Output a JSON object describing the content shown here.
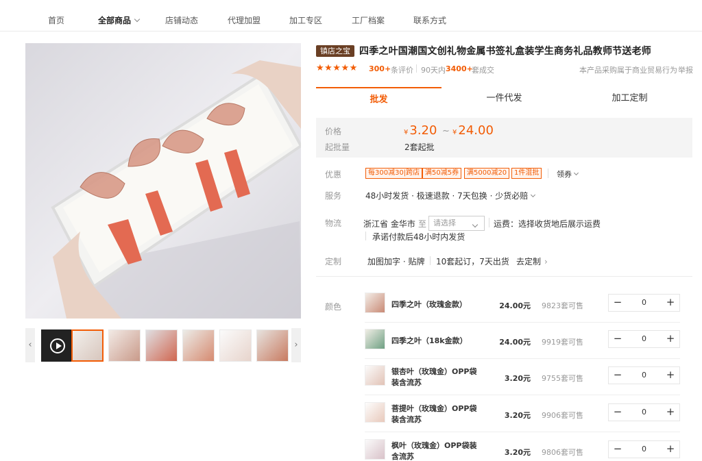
{
  "nav": {
    "items": [
      "首页",
      "全部商品",
      "店铺动态",
      "代理加盟",
      "加工专区",
      "工厂档案",
      "联系方式"
    ]
  },
  "product": {
    "badge": "镇店之宝",
    "title": "四季之叶国潮国文创礼物金属书签礼盒装学生商务礼品教师节送老师",
    "reviews_count": "300+",
    "reviews_label": "条评价",
    "period": "90天内",
    "sold_count": "3400+",
    "sold_label": "套成交",
    "business_note": "本产品采购属于商业贸易行为",
    "report_label": "举报"
  },
  "tabs": [
    "批发",
    "一件代发",
    "加工定制"
  ],
  "pricing": {
    "price_label": "价格",
    "currency": "¥",
    "price_min": "3.20",
    "tilde": "~",
    "price_max": "24.00",
    "moq_label": "起批量",
    "moq_value": "2套起批"
  },
  "offers": {
    "label": "优惠",
    "promos": [
      "每300减30|跨店",
      "满50减5券",
      "满5000减20",
      "1件混批"
    ],
    "coupon_label": "领券"
  },
  "service": {
    "label": "服务",
    "text": "48小时发货 · 极速退款 · 7天包换 · 少货必赔"
  },
  "logistics": {
    "label": "物流",
    "origin": "浙江省 金华市",
    "to": "至",
    "select_placeholder": "请选择",
    "freight": "运费：选择收货地后展示运费",
    "promise": "承诺付款后48小时内发货"
  },
  "custom": {
    "label": "定制",
    "service": "加图加字 · 贴牌",
    "terms": "10套起订，7天出货",
    "link": "去定制"
  },
  "sku_label": "颜色",
  "skus": [
    {
      "name": "四季之叶（玫瑰金款）",
      "price": "24.00元",
      "stock": "9823套可售",
      "qty": "0"
    },
    {
      "name": "四季之叶（18k金款）",
      "price": "24.00元",
      "stock": "9919套可售",
      "qty": "0"
    },
    {
      "name": "银杏叶（玫瑰金）OPP袋装含流苏",
      "price": "3.20元",
      "stock": "9755套可售",
      "qty": "0"
    },
    {
      "name": "菩提叶（玫瑰金）OPP袋装含流苏",
      "price": "3.20元",
      "stock": "9906套可售",
      "qty": "0"
    },
    {
      "name": "枫叶（玫瑰金）OPP袋装含流苏",
      "price": "3.20元",
      "stock": "9806套可售",
      "qty": "0"
    }
  ],
  "stepper": {
    "minus": "−",
    "plus": "+"
  },
  "colors": {
    "accent": "#f25c05",
    "badge": "#6a3f24"
  }
}
